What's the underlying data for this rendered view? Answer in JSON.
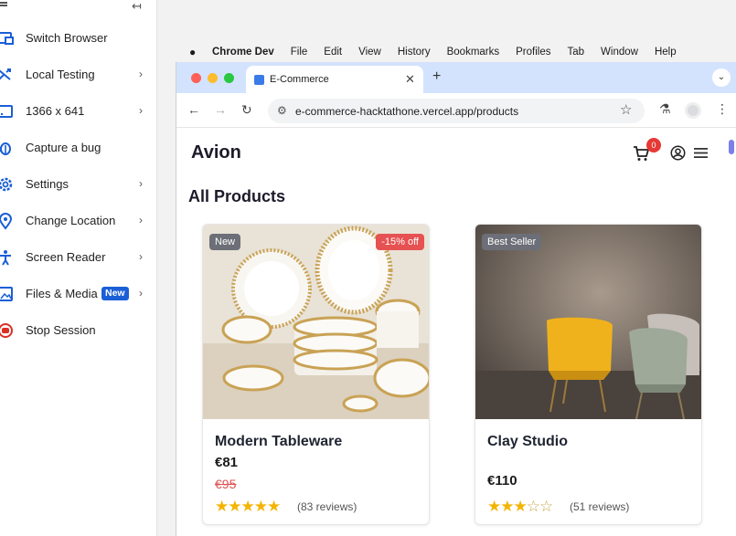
{
  "panel": {
    "items": [
      {
        "label": "Switch Browser",
        "icon": "switch-browser-icon",
        "chevron": false,
        "badge": ""
      },
      {
        "label": "Local Testing",
        "icon": "local-testing-icon",
        "chevron": true,
        "badge": ""
      },
      {
        "label": "1366 x 641",
        "icon": "resolution-icon",
        "chevron": true,
        "badge": ""
      },
      {
        "label": "Capture a bug",
        "icon": "bug-icon",
        "chevron": false,
        "badge": ""
      },
      {
        "label": "Settings",
        "icon": "gear-icon",
        "chevron": true,
        "badge": ""
      },
      {
        "label": "Change Location",
        "icon": "location-pin-icon",
        "chevron": true,
        "badge": ""
      },
      {
        "label": "Screen Reader",
        "icon": "accessibility-icon",
        "chevron": true,
        "badge": ""
      },
      {
        "label": "Files & Media",
        "icon": "image-icon",
        "chevron": true,
        "badge": "New"
      },
      {
        "label": "Stop Session",
        "icon": "stop-icon",
        "chevron": false,
        "badge": ""
      }
    ],
    "accent_color": "#1a5fd6",
    "stop_color": "#d93025"
  },
  "macmenu": {
    "app": "Chrome Dev",
    "items": [
      "File",
      "Edit",
      "View",
      "History",
      "Bookmarks",
      "Profiles",
      "Tab",
      "Window",
      "Help"
    ]
  },
  "browser": {
    "tab_title": "E-Commerce",
    "url": "e-commerce-hacktathone.vercel.app/products"
  },
  "site": {
    "brand": "Avion",
    "cart_count": "0",
    "heading": "All Products",
    "products": [
      {
        "name": "Modern Tableware",
        "price": "€81",
        "old_price": "€95",
        "tag_left": "New",
        "tag_right": "-15% off",
        "rating": 5,
        "reviews": "(83 reviews)"
      },
      {
        "name": "Clay Studio",
        "price": "€110",
        "old_price": "",
        "tag_left": "Best Seller",
        "tag_right": "",
        "rating": 3,
        "reviews": "(51 reviews)"
      }
    ]
  }
}
